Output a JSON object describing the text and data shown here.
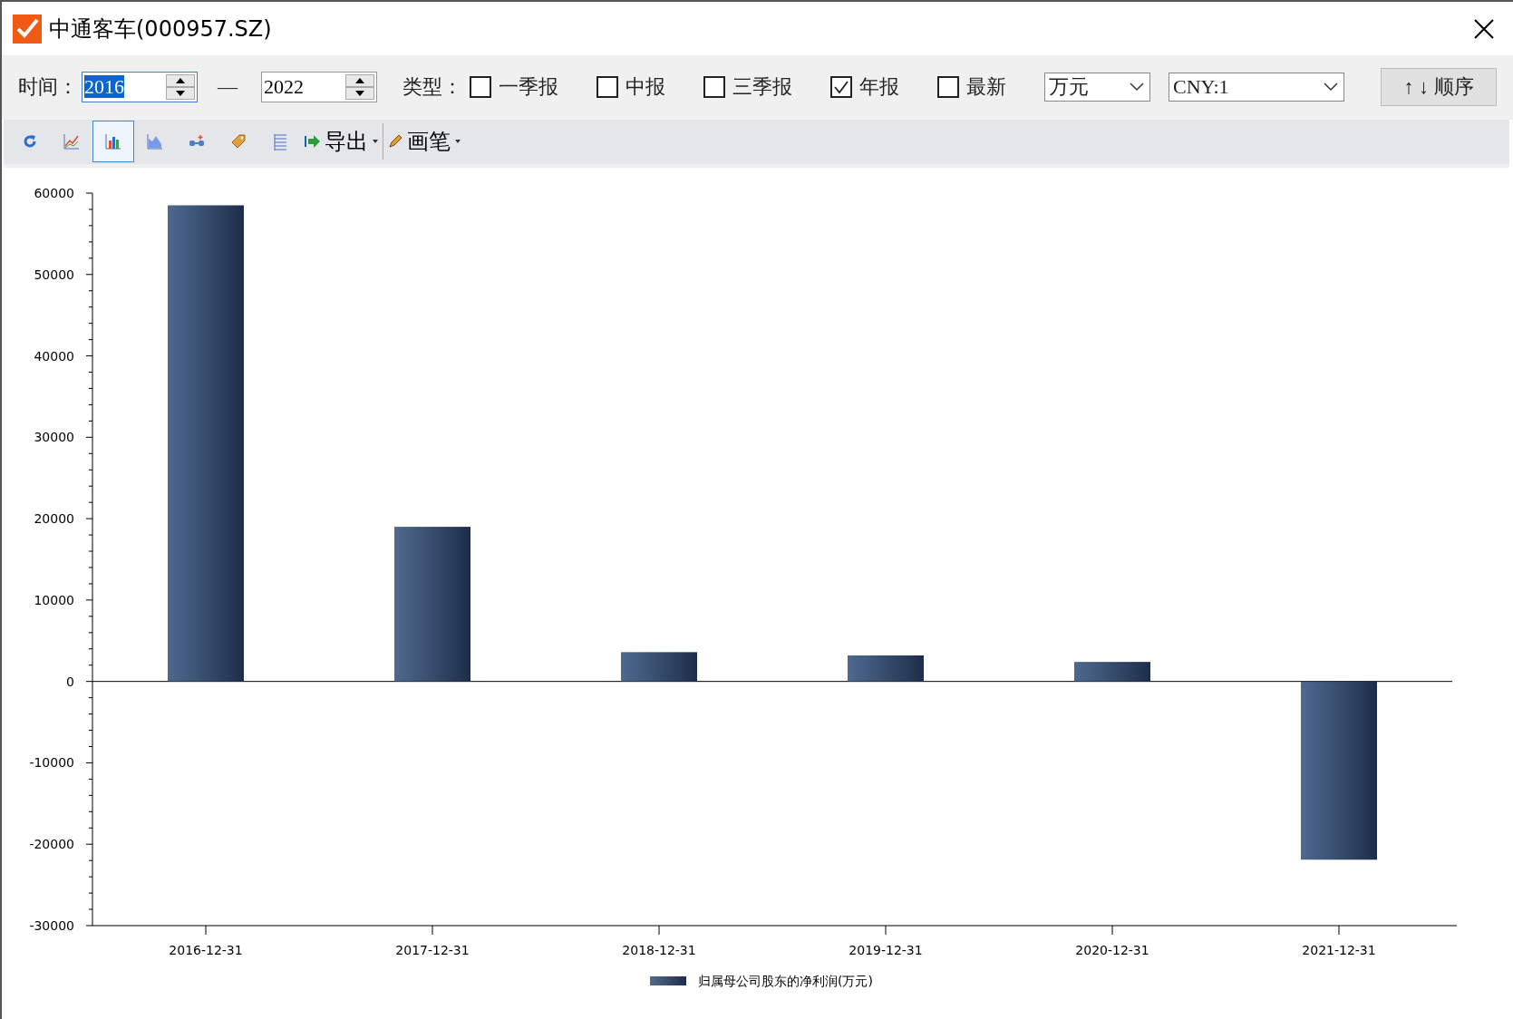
{
  "window": {
    "title": "中通客车(000957.SZ)"
  },
  "filters": {
    "time_label": "时间：",
    "from": {
      "value": "2016",
      "text_selected": true
    },
    "separator": "—",
    "to": {
      "value": "2022",
      "text_selected": false
    },
    "type_label": "类型：",
    "types": [
      {
        "label": "一季报",
        "checked": false
      },
      {
        "label": "中报",
        "checked": false
      },
      {
        "label": "三季报",
        "checked": false
      },
      {
        "label": "年报",
        "checked": true
      },
      {
        "label": "最新",
        "checked": false
      }
    ],
    "unit": "万元",
    "currency": "CNY:1",
    "sort_button": "↑ ↓ 顺序"
  },
  "toolbar": {
    "tools": [
      {
        "kind": "refresh",
        "selected": false
      },
      {
        "kind": "line",
        "selected": false
      },
      {
        "kind": "bar",
        "selected": true
      },
      {
        "kind": "area",
        "selected": false
      },
      {
        "kind": "link",
        "selected": false
      },
      {
        "kind": "tag",
        "selected": false
      },
      {
        "kind": "list",
        "selected": false
      }
    ],
    "export": "导出",
    "pen": "画笔"
  },
  "chart": {
    "chart_data": {
      "type": "bar",
      "categories": [
        "2016-12-31",
        "2017-12-31",
        "2018-12-31",
        "2019-12-31",
        "2020-12-31",
        "2021-12-31"
      ],
      "series": [
        {
          "name": "归属母公司股东的净利润(万元)",
          "color": "#2f4f7a",
          "values": [
            58500,
            19000,
            3600,
            3200,
            2400,
            -21900
          ]
        }
      ],
      "ylim": [
        -30000,
        60000
      ],
      "yticks": [
        -30000,
        -20000,
        -10000,
        0,
        10000,
        20000,
        30000,
        40000,
        50000,
        60000
      ]
    }
  }
}
